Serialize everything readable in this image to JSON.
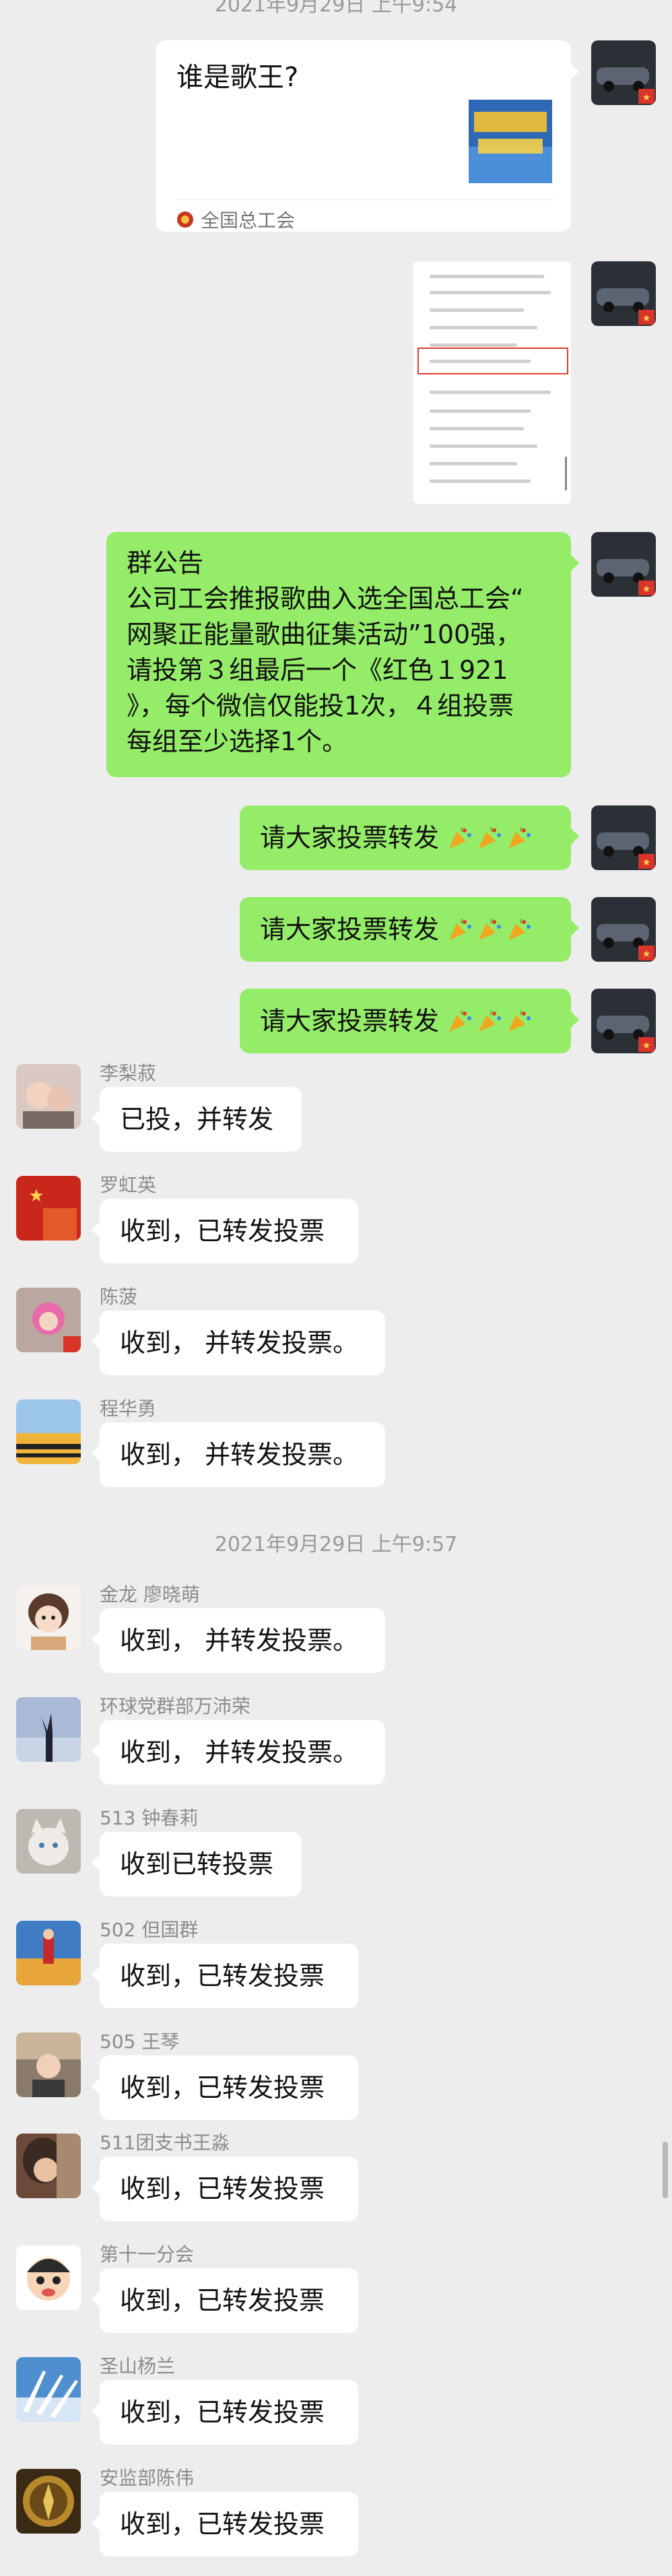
{
  "timestamps": {
    "top_partial": "2021年9月29日 上午9:54",
    "middle": "2021年9月29日 上午9:57"
  },
  "link_card": {
    "title": "谁是歌王?",
    "source": "全国总工会",
    "thumb_text": "你来投 金曲榜"
  },
  "announcement": {
    "title": "群公告",
    "lines": [
      "公司工会推报歌曲入选全国总工会“",
      "网聚正能量歌曲征集活动”100强，",
      "请投第３组最后一个《红色１921",
      "》，每个微信仅能投1次，４组投票",
      "每组至少选择1个。"
    ]
  },
  "my_messages": [
    {
      "text": "请大家投票转发",
      "emoji": [
        "party-popper-icon",
        "party-popper-icon",
        "party-popper-icon"
      ]
    },
    {
      "text": "请大家投票转发",
      "emoji": [
        "party-popper-icon",
        "party-popper-icon",
        "party-popper-icon"
      ]
    },
    {
      "text": "请大家投票转发",
      "emoji": [
        "party-popper-icon",
        "party-popper-icon",
        "party-popper-icon"
      ]
    }
  ],
  "other_messages": [
    {
      "name": "李梨菽",
      "text": "已投，并转发"
    },
    {
      "name": "罗虹英",
      "text": "收到，已转发投票"
    },
    {
      "name": "陈菠",
      "text": "收到， 并转发投票。"
    },
    {
      "name": "程华勇",
      "text": "收到， 并转发投票。"
    },
    {
      "name": "金龙 廖晓萌",
      "text": "收到， 并转发投票。"
    },
    {
      "name": "环球党群部万沛荣",
      "text": "收到， 并转发投票。"
    },
    {
      "name": "513 钟春莉",
      "text": "收到已转投票"
    },
    {
      "name": "502 但国群",
      "text": "收到，已转发投票"
    },
    {
      "name": "505 王琴",
      "text": "收到，已转发投票"
    },
    {
      "name": "511团支书王淼",
      "text": "收到，已转发投票"
    },
    {
      "name": "第十一分会",
      "text": "收到，已转发投票"
    },
    {
      "name": "圣山杨兰",
      "text": "收到，已转发投票"
    },
    {
      "name": "安监部陈伟",
      "text": "收到，已转发投票"
    }
  ],
  "colors": {
    "background": "#ededed",
    "self_bubble": "#95ec69",
    "other_bubble": "#ffffff",
    "meta_text": "#9a9a9a"
  }
}
